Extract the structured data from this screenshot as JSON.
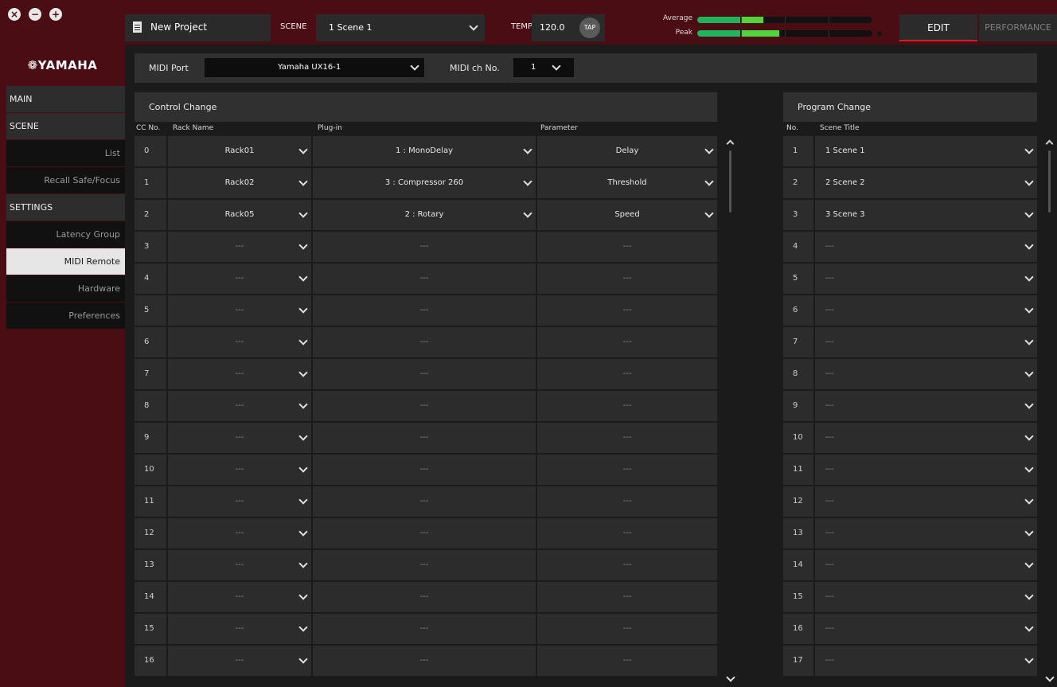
{
  "window_controls": [
    "close-icon",
    "minimize-icon",
    "maximize-icon"
  ],
  "topbar": {
    "project_name": "New Project",
    "scene_label": "SCENE",
    "scene_value": "1  Scene 1",
    "tempo_label": "TEMPO",
    "tempo_value": "120.0",
    "tap_label": "TAP",
    "meter_average_label": "Average",
    "meter_peak_label": "Peak",
    "tab_edit": "EDIT",
    "tab_performance": "PERFORMANCE"
  },
  "colors": {
    "brand_maroon": "#4a0d14",
    "meter_green": "#3fcf3f",
    "active_tab_accent": "#d21d2b"
  },
  "sidebar": {
    "logo": "❁YAMAHA",
    "items": [
      {
        "label": "MAIN",
        "type": "head"
      },
      {
        "label": "SCENE",
        "type": "head"
      },
      {
        "label": "List",
        "type": "sub"
      },
      {
        "label": "Recall Safe/Focus",
        "type": "sub"
      },
      {
        "label": "SETTINGS",
        "type": "head"
      },
      {
        "label": "Latency Group",
        "type": "sub"
      },
      {
        "label": "MIDI Remote",
        "type": "sub",
        "active": true
      },
      {
        "label": "Hardware",
        "type": "sub"
      },
      {
        "label": "Preferences",
        "type": "sub"
      }
    ]
  },
  "midi": {
    "port_label": "MIDI Port",
    "port_value": "Yamaha UX16-1",
    "ch_label": "MIDI ch No.",
    "ch_value": "1"
  },
  "control_change": {
    "title": "Control Change",
    "headers": {
      "cc": "CC No.",
      "rack": "Rack Name",
      "plugin": "Plug-in",
      "param": "Parameter"
    },
    "rows": [
      {
        "cc": "0",
        "rack": "Rack01",
        "plugin": "1 : MonoDelay",
        "param": "Delay"
      },
      {
        "cc": "1",
        "rack": "Rack02",
        "plugin": "3 : Compressor 260",
        "param": "Threshold"
      },
      {
        "cc": "2",
        "rack": "Rack05",
        "plugin": "2 : Rotary",
        "param": "Speed"
      },
      {
        "cc": "3",
        "rack": "---",
        "plugin": "---",
        "param": "---"
      },
      {
        "cc": "4",
        "rack": "---",
        "plugin": "---",
        "param": "---"
      },
      {
        "cc": "5",
        "rack": "---",
        "plugin": "---",
        "param": "---"
      },
      {
        "cc": "6",
        "rack": "---",
        "plugin": "---",
        "param": "---"
      },
      {
        "cc": "7",
        "rack": "---",
        "plugin": "---",
        "param": "---"
      },
      {
        "cc": "8",
        "rack": "---",
        "plugin": "---",
        "param": "---"
      },
      {
        "cc": "9",
        "rack": "---",
        "plugin": "---",
        "param": "---"
      },
      {
        "cc": "10",
        "rack": "---",
        "plugin": "---",
        "param": "---"
      },
      {
        "cc": "11",
        "rack": "---",
        "plugin": "---",
        "param": "---"
      },
      {
        "cc": "12",
        "rack": "---",
        "plugin": "---",
        "param": "---"
      },
      {
        "cc": "13",
        "rack": "---",
        "plugin": "---",
        "param": "---"
      },
      {
        "cc": "14",
        "rack": "---",
        "plugin": "---",
        "param": "---"
      },
      {
        "cc": "15",
        "rack": "---",
        "plugin": "---",
        "param": "---"
      },
      {
        "cc": "16",
        "rack": "---",
        "plugin": "---",
        "param": "---"
      }
    ]
  },
  "program_change": {
    "title": "Program Change",
    "headers": {
      "no": "No.",
      "title": "Scene Title"
    },
    "rows": [
      {
        "no": "1",
        "title": "1  Scene 1"
      },
      {
        "no": "2",
        "title": "2  Scene 2"
      },
      {
        "no": "3",
        "title": "3  Scene 3"
      },
      {
        "no": "4",
        "title": "---"
      },
      {
        "no": "5",
        "title": "---"
      },
      {
        "no": "6",
        "title": "---"
      },
      {
        "no": "7",
        "title": "---"
      },
      {
        "no": "8",
        "title": "---"
      },
      {
        "no": "9",
        "title": "---"
      },
      {
        "no": "10",
        "title": "---"
      },
      {
        "no": "11",
        "title": "---"
      },
      {
        "no": "12",
        "title": "---"
      },
      {
        "no": "13",
        "title": "---"
      },
      {
        "no": "14",
        "title": "---"
      },
      {
        "no": "15",
        "title": "---"
      },
      {
        "no": "16",
        "title": "---"
      },
      {
        "no": "17",
        "title": "---"
      }
    ]
  }
}
